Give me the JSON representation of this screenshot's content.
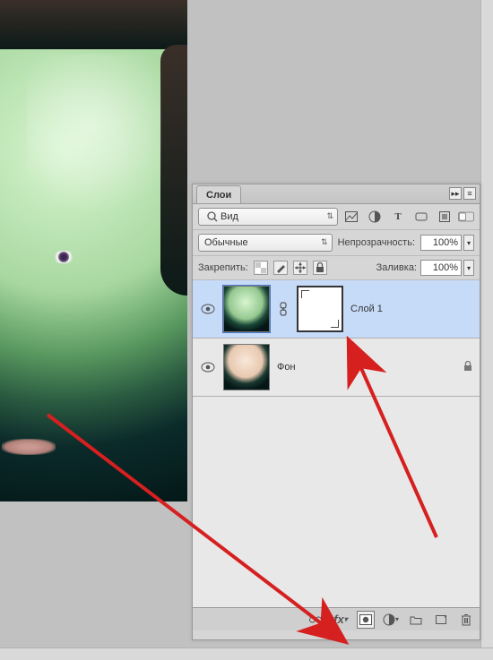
{
  "panel": {
    "tab_label": "Слои",
    "row1": {
      "search_label": "Вид"
    },
    "icons": {
      "image": "image-filter-icon",
      "adjust": "adjustment-filter-icon",
      "type": "type-filter-icon",
      "shape": "shape-filter-icon",
      "smart": "smartobject-filter-icon"
    },
    "blend_mode": "Обычные",
    "opacity_label": "Непрозрачность:",
    "opacity_value": "100%",
    "lock_label": "Закрепить:",
    "fill_label": "Заливка:",
    "fill_value": "100%"
  },
  "layers": [
    {
      "visible": true,
      "has_mask": true,
      "name": "Слой 1",
      "locked": false,
      "selected": true
    },
    {
      "visible": true,
      "has_mask": false,
      "name": "Фон",
      "locked": true,
      "selected": false
    }
  ],
  "footer_icons": {
    "link": "⧉",
    "fx": "fx",
    "mask": "◻",
    "adj": "◐",
    "group": "▭",
    "new": "▫",
    "trash": "🗑"
  }
}
